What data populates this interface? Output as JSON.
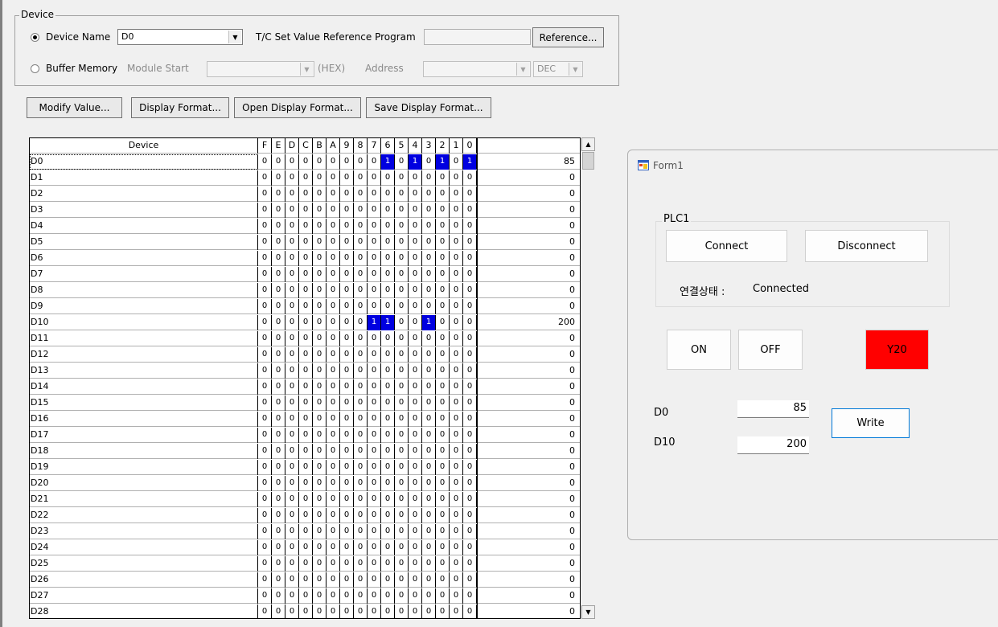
{
  "device_group": {
    "title": "Device",
    "device_name_label": "Device Name",
    "device_name_value": "D0",
    "tc_label": "T/C Set Value Reference Program",
    "reference_label": "Reference...",
    "buffer_memory_label": "Buffer Memory",
    "module_start_label": "Module Start",
    "hex_label": "(HEX)",
    "address_label": "Address",
    "address_format": "DEC"
  },
  "toolbar": {
    "modify_value": "Modify Value...",
    "display_format": "Display Format...",
    "open_display_format": "Open Display Format...",
    "save_display_format": "Save Display Format..."
  },
  "grid": {
    "device_header": "Device",
    "bit_headers": [
      "F",
      "E",
      "D",
      "C",
      "B",
      "A",
      "9",
      "8",
      "7",
      "6",
      "5",
      "4",
      "3",
      "2",
      "1",
      "0"
    ],
    "rows": [
      {
        "device": "D0",
        "bits": [
          0,
          0,
          0,
          0,
          0,
          0,
          0,
          0,
          0,
          1,
          0,
          1,
          0,
          1,
          0,
          1
        ],
        "value": "85"
      },
      {
        "device": "D1",
        "bits": [
          0,
          0,
          0,
          0,
          0,
          0,
          0,
          0,
          0,
          0,
          0,
          0,
          0,
          0,
          0,
          0
        ],
        "value": "0"
      },
      {
        "device": "D2",
        "bits": [
          0,
          0,
          0,
          0,
          0,
          0,
          0,
          0,
          0,
          0,
          0,
          0,
          0,
          0,
          0,
          0
        ],
        "value": "0"
      },
      {
        "device": "D3",
        "bits": [
          0,
          0,
          0,
          0,
          0,
          0,
          0,
          0,
          0,
          0,
          0,
          0,
          0,
          0,
          0,
          0
        ],
        "value": "0"
      },
      {
        "device": "D4",
        "bits": [
          0,
          0,
          0,
          0,
          0,
          0,
          0,
          0,
          0,
          0,
          0,
          0,
          0,
          0,
          0,
          0
        ],
        "value": "0"
      },
      {
        "device": "D5",
        "bits": [
          0,
          0,
          0,
          0,
          0,
          0,
          0,
          0,
          0,
          0,
          0,
          0,
          0,
          0,
          0,
          0
        ],
        "value": "0"
      },
      {
        "device": "D6",
        "bits": [
          0,
          0,
          0,
          0,
          0,
          0,
          0,
          0,
          0,
          0,
          0,
          0,
          0,
          0,
          0,
          0
        ],
        "value": "0"
      },
      {
        "device": "D7",
        "bits": [
          0,
          0,
          0,
          0,
          0,
          0,
          0,
          0,
          0,
          0,
          0,
          0,
          0,
          0,
          0,
          0
        ],
        "value": "0"
      },
      {
        "device": "D8",
        "bits": [
          0,
          0,
          0,
          0,
          0,
          0,
          0,
          0,
          0,
          0,
          0,
          0,
          0,
          0,
          0,
          0
        ],
        "value": "0"
      },
      {
        "device": "D9",
        "bits": [
          0,
          0,
          0,
          0,
          0,
          0,
          0,
          0,
          0,
          0,
          0,
          0,
          0,
          0,
          0,
          0
        ],
        "value": "0"
      },
      {
        "device": "D10",
        "bits": [
          0,
          0,
          0,
          0,
          0,
          0,
          0,
          0,
          1,
          1,
          0,
          0,
          1,
          0,
          0,
          0
        ],
        "value": "200"
      },
      {
        "device": "D11",
        "bits": [
          0,
          0,
          0,
          0,
          0,
          0,
          0,
          0,
          0,
          0,
          0,
          0,
          0,
          0,
          0,
          0
        ],
        "value": "0"
      },
      {
        "device": "D12",
        "bits": [
          0,
          0,
          0,
          0,
          0,
          0,
          0,
          0,
          0,
          0,
          0,
          0,
          0,
          0,
          0,
          0
        ],
        "value": "0"
      },
      {
        "device": "D13",
        "bits": [
          0,
          0,
          0,
          0,
          0,
          0,
          0,
          0,
          0,
          0,
          0,
          0,
          0,
          0,
          0,
          0
        ],
        "value": "0"
      },
      {
        "device": "D14",
        "bits": [
          0,
          0,
          0,
          0,
          0,
          0,
          0,
          0,
          0,
          0,
          0,
          0,
          0,
          0,
          0,
          0
        ],
        "value": "0"
      },
      {
        "device": "D15",
        "bits": [
          0,
          0,
          0,
          0,
          0,
          0,
          0,
          0,
          0,
          0,
          0,
          0,
          0,
          0,
          0,
          0
        ],
        "value": "0"
      },
      {
        "device": "D16",
        "bits": [
          0,
          0,
          0,
          0,
          0,
          0,
          0,
          0,
          0,
          0,
          0,
          0,
          0,
          0,
          0,
          0
        ],
        "value": "0"
      },
      {
        "device": "D17",
        "bits": [
          0,
          0,
          0,
          0,
          0,
          0,
          0,
          0,
          0,
          0,
          0,
          0,
          0,
          0,
          0,
          0
        ],
        "value": "0"
      },
      {
        "device": "D18",
        "bits": [
          0,
          0,
          0,
          0,
          0,
          0,
          0,
          0,
          0,
          0,
          0,
          0,
          0,
          0,
          0,
          0
        ],
        "value": "0"
      },
      {
        "device": "D19",
        "bits": [
          0,
          0,
          0,
          0,
          0,
          0,
          0,
          0,
          0,
          0,
          0,
          0,
          0,
          0,
          0,
          0
        ],
        "value": "0"
      },
      {
        "device": "D20",
        "bits": [
          0,
          0,
          0,
          0,
          0,
          0,
          0,
          0,
          0,
          0,
          0,
          0,
          0,
          0,
          0,
          0
        ],
        "value": "0"
      },
      {
        "device": "D21",
        "bits": [
          0,
          0,
          0,
          0,
          0,
          0,
          0,
          0,
          0,
          0,
          0,
          0,
          0,
          0,
          0,
          0
        ],
        "value": "0"
      },
      {
        "device": "D22",
        "bits": [
          0,
          0,
          0,
          0,
          0,
          0,
          0,
          0,
          0,
          0,
          0,
          0,
          0,
          0,
          0,
          0
        ],
        "value": "0"
      },
      {
        "device": "D23",
        "bits": [
          0,
          0,
          0,
          0,
          0,
          0,
          0,
          0,
          0,
          0,
          0,
          0,
          0,
          0,
          0,
          0
        ],
        "value": "0"
      },
      {
        "device": "D24",
        "bits": [
          0,
          0,
          0,
          0,
          0,
          0,
          0,
          0,
          0,
          0,
          0,
          0,
          0,
          0,
          0,
          0
        ],
        "value": "0"
      },
      {
        "device": "D25",
        "bits": [
          0,
          0,
          0,
          0,
          0,
          0,
          0,
          0,
          0,
          0,
          0,
          0,
          0,
          0,
          0,
          0
        ],
        "value": "0"
      },
      {
        "device": "D26",
        "bits": [
          0,
          0,
          0,
          0,
          0,
          0,
          0,
          0,
          0,
          0,
          0,
          0,
          0,
          0,
          0,
          0
        ],
        "value": "0"
      },
      {
        "device": "D27",
        "bits": [
          0,
          0,
          0,
          0,
          0,
          0,
          0,
          0,
          0,
          0,
          0,
          0,
          0,
          0,
          0,
          0
        ],
        "value": "0"
      },
      {
        "device": "D28",
        "bits": [
          0,
          0,
          0,
          0,
          0,
          0,
          0,
          0,
          0,
          0,
          0,
          0,
          0,
          0,
          0,
          0
        ],
        "value": "0"
      }
    ]
  },
  "form1": {
    "title": "Form1",
    "icon": "form-icon",
    "plc_group": "PLC1",
    "connect": "Connect",
    "disconnect": "Disconnect",
    "status_label": "연결상태 :",
    "status_value": "Connected",
    "on": "ON",
    "off": "OFF",
    "y20": "Y20",
    "y20_color": "#ff0000",
    "d0_label": "D0",
    "d0_value": "85",
    "d10_label": "D10",
    "d10_value": "200",
    "write": "Write"
  },
  "colors": {
    "bit_on_bg": "#0000e0",
    "bit_on_fg": "#ffffff"
  }
}
